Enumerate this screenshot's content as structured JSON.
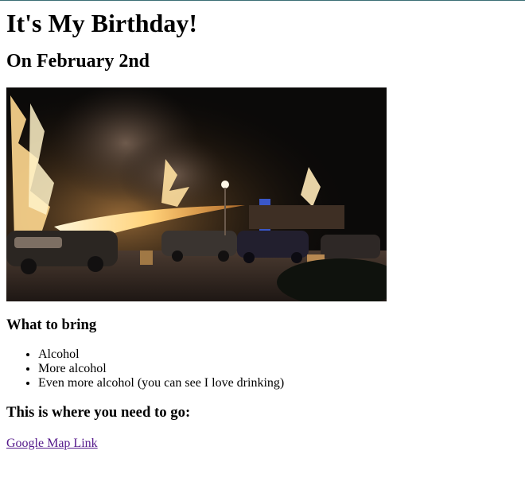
{
  "page": {
    "title": "It's My Birthday!",
    "date_heading": "On February 2nd",
    "image_alt": "Night street scene with a person on a car roof shooting a flamethrower at burning trees and cars",
    "bring_heading": "What to bring",
    "bring_items": [
      "Alcohol",
      "More alcohol",
      "Even more alcohol (you can see I love drinking)"
    ],
    "where_heading": "This is where you need to go:",
    "map_link_text": "Google Map Link"
  },
  "colors": {
    "visited_link": "#551a8b",
    "top_border": "#3b6e74"
  }
}
